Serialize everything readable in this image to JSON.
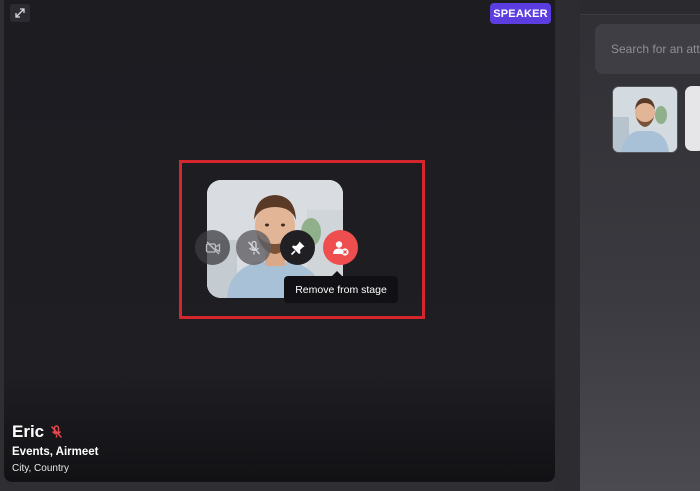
{
  "stage": {
    "badge": "SPEAKER",
    "tooltip": "Remove from stage",
    "speaker": {
      "name": "Eric",
      "company": "Events, Airmeet",
      "location": "City, Country"
    }
  },
  "sidebar": {
    "search_placeholder": "Search for an att"
  },
  "colors": {
    "badge": "#5b3de0",
    "remove": "#ef4e4e",
    "highlight": "#d4262c",
    "muted_mic": "#e5484d"
  }
}
